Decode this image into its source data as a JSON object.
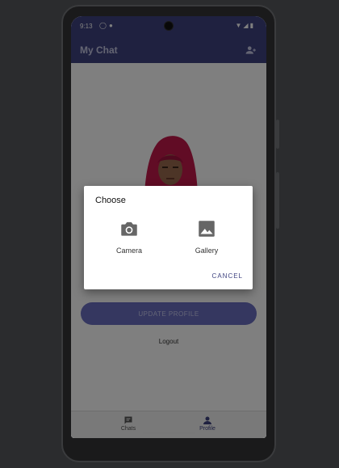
{
  "status": {
    "time": "9:13"
  },
  "appbar": {
    "title": "My Chat"
  },
  "profile": {
    "update_label": "UPDATE PROFILE",
    "logout_label": "Logout"
  },
  "nav": {
    "chats_label": "Chats",
    "profile_label": "Profile"
  },
  "dialog": {
    "title": "Choose",
    "options": [
      {
        "label": "Camera",
        "icon": "camera-icon"
      },
      {
        "label": "Gallery",
        "icon": "image-icon"
      }
    ],
    "cancel_label": "CANCEL"
  },
  "colors": {
    "primary": "#3f4380",
    "button": "#6a6fc1",
    "hijab": "#c2184b"
  }
}
